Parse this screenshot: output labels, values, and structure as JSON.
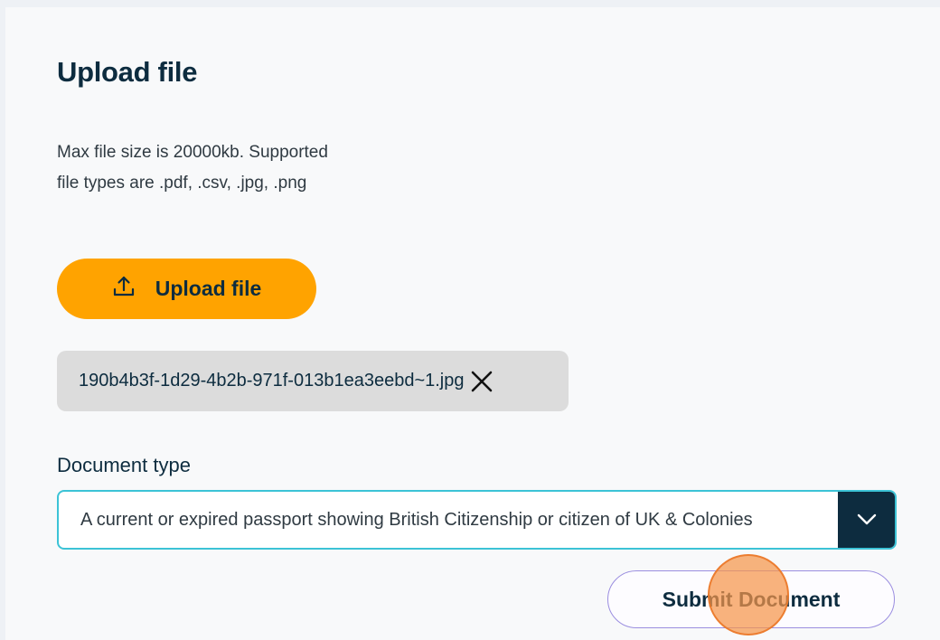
{
  "upload": {
    "title": "Upload file",
    "hint_line1": "Max file size is 20000kb. Supported",
    "hint_line2": "file types are .pdf, .csv, .jpg, .png",
    "button_label": "Upload file",
    "button_icon": "upload-icon"
  },
  "file": {
    "name": "190b4b3f-1d29-4b2b-971f-013b1ea3eebd~1.jpg",
    "remove_icon": "close-icon"
  },
  "document_type": {
    "label": "Document type",
    "selected": "A current or expired passport showing British Citizenship or citizen of UK & Colonies",
    "dropdown_icon": "chevron-down-icon"
  },
  "submit": {
    "label": "Submit Document"
  },
  "colors": {
    "primary_button": "#ffa300",
    "text_dark": "#0d2c3f",
    "select_border": "#3cc3d6",
    "submit_border": "#9b8ee0",
    "chip_background": "#dcdcdc"
  }
}
